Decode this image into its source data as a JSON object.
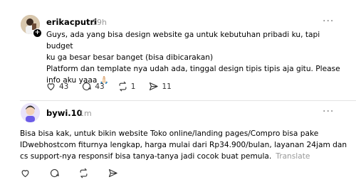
{
  "post1": {
    "username": "erikacputri",
    "time": "19h",
    "text": "Guys, ada yang bisa design website ga untuk kebutuhan pribadi ku, tapi budget\nku ga besar besar banget (bisa dibicarakan)\nPlatform dan template nya udah ada, tinggal design tipis tipis aja gitu. Please\ninfo aku yaaa 🙏🏻",
    "likes": "43",
    "comments": "43",
    "reposts": "1",
    "shares": "11"
  },
  "post2": {
    "username": "bywi.10",
    "time": "1m",
    "text": "Bisa bisa kak, untuk bikin website Toko online/landing pages/Compro bisa pake\nIDwebhostcom fiturnya lengkap, harga mulai dari Rp34.900/bulan, layanan 24jam dan\ncs support-nya responsif bisa tanya-tanya jadi cocok buat pemula.",
    "translate": "Translate"
  },
  "more_label": "···",
  "colors": {
    "muted": "#999999",
    "divider": "#e3e3e3",
    "text": "#000000"
  }
}
